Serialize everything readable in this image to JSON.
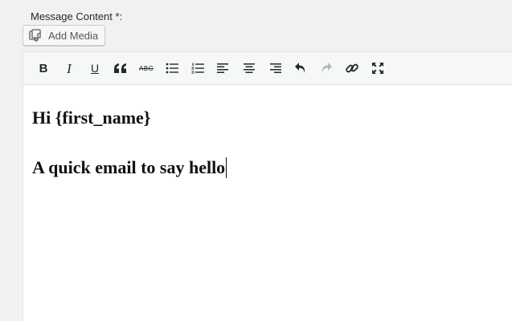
{
  "field": {
    "label": "Message Content *:"
  },
  "media": {
    "add_media_label": "Add Media"
  },
  "toolbar": {
    "buttons": [
      {
        "name": "bold",
        "icon": "bold-icon",
        "glyph": "B"
      },
      {
        "name": "italic",
        "icon": "italic-icon",
        "glyph": "I"
      },
      {
        "name": "underline",
        "icon": "underline-icon",
        "glyph": "U"
      },
      {
        "name": "blockquote",
        "icon": "quote-icon"
      },
      {
        "name": "strikethrough",
        "icon": "strikethrough-icon",
        "glyph": "ABC"
      },
      {
        "name": "bullet-list",
        "icon": "bullet-list-icon"
      },
      {
        "name": "numbered-list",
        "icon": "numbered-list-icon"
      },
      {
        "name": "align-left",
        "icon": "align-left-icon"
      },
      {
        "name": "align-center",
        "icon": "align-center-icon"
      },
      {
        "name": "align-right",
        "icon": "align-right-icon"
      },
      {
        "name": "undo",
        "icon": "undo-icon"
      },
      {
        "name": "redo",
        "icon": "redo-icon",
        "disabled": true
      },
      {
        "name": "link",
        "icon": "link-icon"
      },
      {
        "name": "fullscreen",
        "icon": "fullscreen-icon"
      }
    ]
  },
  "editor": {
    "lines": [
      "Hi {first_name}",
      "A quick email to say hello"
    ]
  }
}
